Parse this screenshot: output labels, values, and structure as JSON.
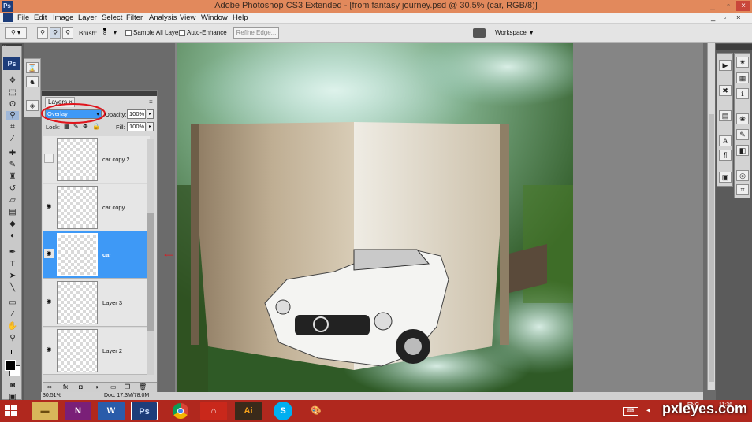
{
  "window": {
    "app_badge": "Ps",
    "title": "Adobe Photoshop CS3 Extended - [from fantasy journey.psd @ 30.5% (car, RGB/8)]",
    "controls": [
      "_",
      "▫",
      "×"
    ]
  },
  "menubar": {
    "items": [
      "File",
      "Edit",
      "Image",
      "Layer",
      "Select",
      "Filter",
      "Analysis",
      "View",
      "Window",
      "Help"
    ],
    "doc_controls": [
      "_",
      "▫",
      "×"
    ]
  },
  "options_bar": {
    "brush_label": "Brush:",
    "brush_size": "8",
    "sample_all_layers": "Sample All Layers",
    "auto_enhance": "Auto-Enhance",
    "refine_edge": "Refine Edge...",
    "workspace": "Workspace ▼"
  },
  "toolbox": {
    "logo": "Ps"
  },
  "layers_panel": {
    "tab_label": "Layers ×",
    "blend_mode": "Overlay",
    "opacity_label": "Opacity:",
    "opacity_value": "100%",
    "lock_label": "Lock:",
    "fill_label": "Fill:",
    "fill_value": "100%",
    "layers": [
      {
        "name": "car copy 2",
        "visible": false,
        "selected": false
      },
      {
        "name": "car copy",
        "visible": true,
        "selected": false
      },
      {
        "name": "car",
        "visible": true,
        "selected": true
      },
      {
        "name": "Layer 3",
        "visible": true,
        "selected": false
      },
      {
        "name": "Layer 2",
        "visible": true,
        "selected": false
      }
    ],
    "footer_icons": [
      "link-icon",
      "fx-icon",
      "mask-icon",
      "adjustment-icon",
      "group-icon",
      "new-layer-icon",
      "trash-icon"
    ]
  },
  "status_bar": {
    "zoom": "30.51%",
    "doc_info": "Doc: 17.3M/78.0M"
  },
  "annotation": {
    "arrow": "←",
    "arrow_color": "#e0141c",
    "circle_color": "#e0141c"
  },
  "taskbar": {
    "language": "ENG",
    "time": "11:36",
    "watermark": "pxleyes.com"
  },
  "colors": {
    "title_bar": "#e2895c",
    "taskbar": "#b0281e",
    "selection": "#3e99f6"
  }
}
